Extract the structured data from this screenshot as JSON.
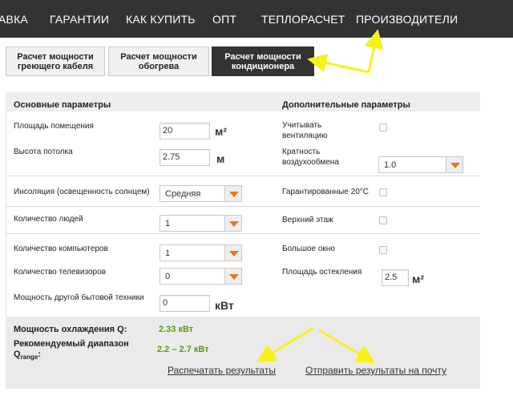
{
  "nav": {
    "items": [
      "АВКА",
      "ГАРАНТИИ",
      "КАК КУПИТЬ",
      "ОПТ",
      "ТЕПЛОРАСЧЕТ",
      "ПРОИЗВОДИТЕЛИ"
    ]
  },
  "tabs": [
    {
      "label": "Расчет мощности греющего кабеля",
      "active": false
    },
    {
      "label": "Расчет мощности обогрева",
      "active": false
    },
    {
      "label": "Расчет мощности кондиционера",
      "active": true
    }
  ],
  "sections": {
    "main": "Основные параметры",
    "extra": "Дополнительные параметры"
  },
  "fields": {
    "area": {
      "label": "Площадь помещения",
      "value": "20",
      "unit": "м²"
    },
    "height": {
      "label": "Высота потолка",
      "value": "2.75",
      "unit": "м"
    },
    "insolation": {
      "label": "Инсоляция (освещенность солнцем)",
      "value": "Средняя"
    },
    "people": {
      "label": "Количество людей",
      "value": "1"
    },
    "computers": {
      "label": "Количество компьютеров",
      "value": "1"
    },
    "tvs": {
      "label": "Количество телевизоров",
      "value": "0"
    },
    "appliances": {
      "label": "Мощность другой бытовой техники",
      "value": "0",
      "unit": "кВт"
    },
    "ventilation": {
      "label": "Учитывать вентиляцию",
      "checked": false
    },
    "air_exchange": {
      "label": "Кратность воздухообмена",
      "value": "1.0"
    },
    "guaranteed": {
      "label": "Гарантированные 20°С",
      "checked": false
    },
    "top_floor": {
      "label": "Верхний этаж",
      "checked": false
    },
    "big_window": {
      "label": "Большое окно",
      "checked": false
    },
    "glazing": {
      "label": "Площадь остекления",
      "value": "2.5",
      "unit": "м²"
    }
  },
  "results": {
    "power_label": "Мощность охлаждения Q:",
    "power_value": "2.33 кВт",
    "range_label_1": "Рекомендуемый диапазон",
    "range_label_2": "Q",
    "range_label_sub": "range",
    "range_label_colon": ":",
    "range_value": "2.2 – 2.7 кВт",
    "print_link": "Распечатать результаты",
    "email_link": "Отправить результаты на почту"
  },
  "colors": {
    "nav_bg": "#333333",
    "accent_arrow": "#e07a1c",
    "result_green": "#5a9a1c",
    "annotation_yellow": "#f7f11a"
  }
}
